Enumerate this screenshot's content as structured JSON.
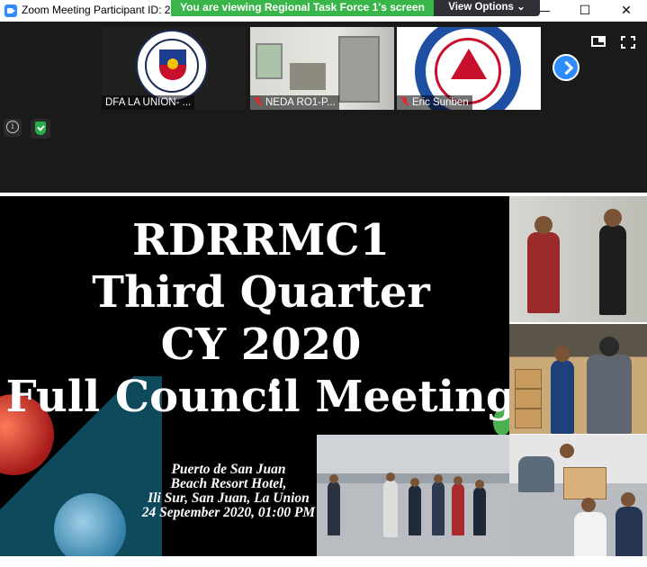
{
  "window": {
    "title": "Zoom Meeting Participant ID: 2",
    "share_banner": "You are viewing Regional Task Force 1's screen",
    "view_options_label": "View Options ⌄",
    "minimize_glyph": "—",
    "maximize_glyph": "☐",
    "close_glyph": "✕"
  },
  "gallery": {
    "participants": [
      {
        "name": "DFA LA UNION- ...",
        "muted": false,
        "video": "dfa-seal"
      },
      {
        "name": "NEDA RO1-P...",
        "muted": true,
        "video": "office-room"
      },
      {
        "name": "Eric Suriben",
        "muted": true,
        "video": "lto-logo"
      }
    ]
  },
  "icons": {
    "next_page": "chevron-right-icon",
    "layout": "layout-icon",
    "fullscreen": "fullscreen-icon",
    "info": "info-icon",
    "encryption": "shield-check-icon"
  },
  "slide": {
    "title_lines": [
      "RDRRMC1",
      "Third Quarter",
      "CY 2020",
      "Full Council Meeting"
    ],
    "venue_lines": [
      "Puerto de San Juan",
      "Beach Resort Hotel,",
      "Ili Sur, San Juan, La Union",
      "24 September 2020, 01:00 PM"
    ]
  },
  "colors": {
    "share_banner": "#3ab54a",
    "zoom_blue": "#2d8cff",
    "encryption_green": "#27ae48",
    "muted_red": "#e02828"
  }
}
